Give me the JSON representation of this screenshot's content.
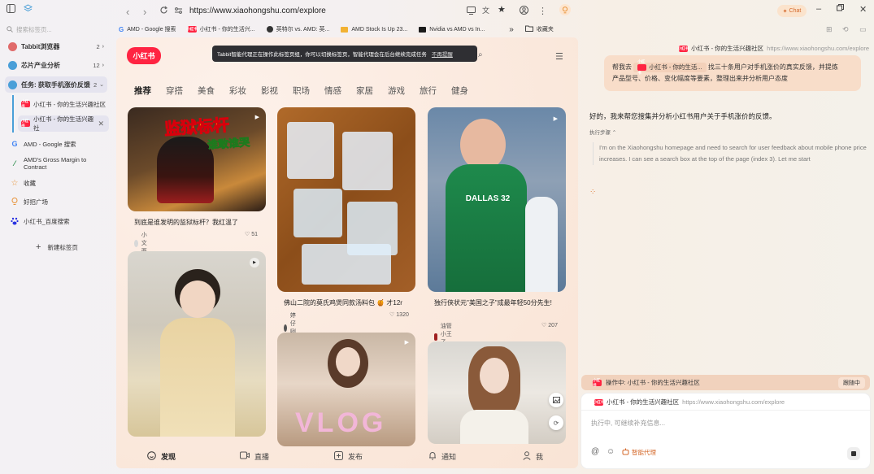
{
  "sidebar": {
    "search_placeholder": "搜索标签页...",
    "groups": [
      {
        "label": "Tabbit浏览器",
        "count": "2",
        "color": "#e06a6a"
      },
      {
        "label": "芯片产业分析",
        "count": "12",
        "color": "#4a9fd8"
      },
      {
        "label": "任务: 获取手机涨价反馈",
        "count": "2",
        "color": "#4a9fd8"
      }
    ],
    "subtabs": [
      "小红书 - 你的生活兴趣社区",
      "小红书 - 你的生活兴趣社"
    ],
    "tabs": [
      {
        "label": "AMD - Google 搜索",
        "icon": "google-icon"
      },
      {
        "label": "AMD's Gross Margin to Contract",
        "icon": "leaf-icon"
      },
      {
        "label": "收藏",
        "icon": "star-icon"
      },
      {
        "label": "好招广场",
        "icon": "bulb-icon"
      },
      {
        "label": "小红书_百度搜索",
        "icon": "baidu-icon"
      }
    ],
    "new_tab": "新建标签页",
    "xhs_badge": "小红书"
  },
  "topbar": {
    "url": "https://www.xiaohongshu.com/explore",
    "chat_label": "Chat",
    "bookmarks": [
      {
        "label": "AMD - Google 搜索",
        "icon": "google-icon"
      },
      {
        "label": "小红书 - 你的生活兴...",
        "icon": "xhs-icon"
      },
      {
        "label": "英特尔 vs. AMD: 英...",
        "icon": "github-icon"
      },
      {
        "label": "AMD Stock Is Up 23...",
        "icon": "amd-icon"
      },
      {
        "label": "Nvidia vs AMD vs In...",
        "icon": "nvidia-icon"
      }
    ],
    "more": "»",
    "favorites_folder": "收藏夹"
  },
  "page": {
    "logo": "小红书",
    "tooltip": "Tabbit智能代理正在操作此标签页组，你可以切换标签页，智能代理会在后台继续完成任务",
    "tooltip_dismiss": "不再提醒",
    "categories": [
      "推荐",
      "穿搭",
      "美食",
      "彩妆",
      "影视",
      "职场",
      "情感",
      "家居",
      "游戏",
      "旅行",
      "健身"
    ],
    "cards": [
      {
        "title": "到底是谁发明的监狱标杆？我红温了",
        "author": "小文西",
        "likes": "51",
        "overlay": "监狱标杆",
        "overlay2": "谁敢谁哭"
      },
      {
        "title": "佛山二院的莫氏鸡煲同款汤料包 🍯 才12r",
        "author": "婷仔咧咧",
        "likes": "1320"
      },
      {
        "title": "独行侠状元\"美国之子\"成最年轻50分先生!",
        "author": "油管小王子Terry",
        "likes": "207",
        "jersey": "DALLAS 32"
      },
      {
        "vlog": "VLOG"
      }
    ],
    "bottom_nav": [
      "发现",
      "直播",
      "发布",
      "通知",
      "我"
    ]
  },
  "panel": {
    "source_title": "小红书 - 你的生活兴趣社区",
    "source_url": "https://www.xiaohongshu.com/explore",
    "user_msg_prefix": "帮我去",
    "user_chip": "小红书 - 你的生活...",
    "user_msg_rest": "找三十条用户对手机涨价的真实反馈，并提炼",
    "user_msg_line2": "产品型号、价格、变化幅度等要素，整理出来并分析用户态度",
    "reply": "好的，我来帮您搜集并分析小红书用户关于手机涨价的反馈。",
    "steps_label": "执行步骤 ⌃",
    "thought": "I'm on the Xiaohongshu homepage and need to search for user feedback about mobile phone price increases. I can see a search box at the top of the page (index 3). Let me start",
    "op_label": "操作中: 小红书 - 你的生活兴趣社区",
    "follow_label": "跟随中",
    "input_placeholder": "执行中, 可继续补充信息...",
    "agent_label": "智能代理"
  },
  "colors": {
    "brand": "#ff2442",
    "accent": "#d4682a"
  }
}
